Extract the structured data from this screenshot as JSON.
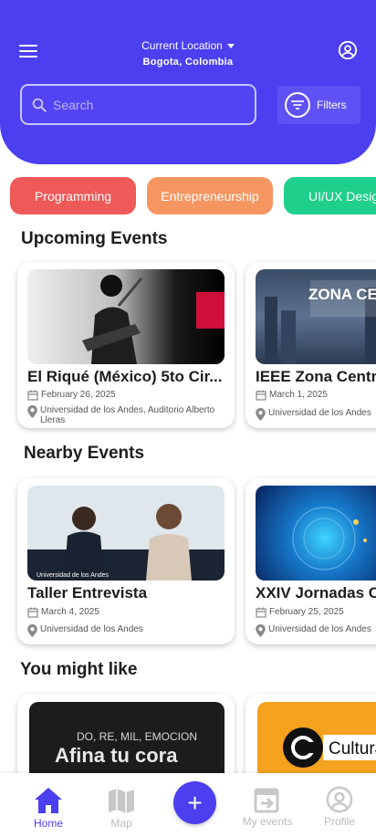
{
  "header": {
    "location_label": "Current Location",
    "location_value": "Bogota, Colombia",
    "search_placeholder": "Search",
    "filters_label": "Filters",
    "color": "#4B3FF0"
  },
  "categories": [
    {
      "label": "Programming",
      "color": "#EE5A57"
    },
    {
      "label": "Entrepreneurship",
      "color": "#F59661"
    },
    {
      "label": "UI/UX Desig",
      "color": "#1FCF8C"
    }
  ],
  "sections": {
    "upcoming": "Upcoming Events",
    "nearby": "Nearby Events",
    "might_like": "You might like"
  },
  "upcoming_events": [
    {
      "title": "El Riqué (México) 5to Cir...",
      "date": "February 26, 2025",
      "place": "Universidad de los Andes, Auditorio Alberto Lleras"
    },
    {
      "title": "IEEE Zona Centro",
      "date": "March 1, 2025",
      "place": "Universidad de los Andes",
      "image_text": "ZONA CENT UNIANDE"
    }
  ],
  "nearby_events": [
    {
      "title": "Taller Entrevista",
      "date": "March 4, 2025",
      "place": "Universidad de los Andes"
    },
    {
      "title": "XXIV Jornadas C",
      "date": "February 25, 2025",
      "place": "Universidad de los Andes"
    }
  ],
  "might_like_events": [
    {
      "image_text_top": "DO, RE, MIL, EMOCION",
      "image_text_main": "Afina tu cora"
    },
    {
      "image_text_main": "Cultura"
    }
  ],
  "bottom_nav": {
    "home": "Home",
    "map": "Map",
    "add": "+",
    "my_events": "My events",
    "profile": "Profile"
  }
}
